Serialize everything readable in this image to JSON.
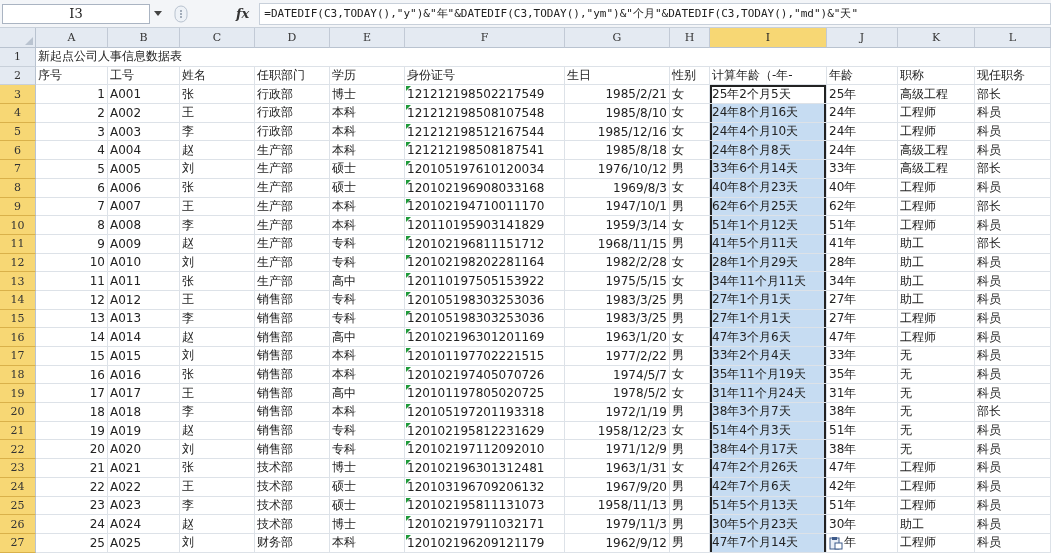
{
  "formula_bar": {
    "name_box": "I3",
    "function_button": "fx",
    "formula": "=DATEDIF(C3,TODAY(),\"y\")&\"年\"&DATEDIF(C3,TODAY(),\"ym\")&\"个月\"&DATEDIF(C3,TODAY(),\"md\")&\"天\""
  },
  "columns": [
    {
      "label": "A",
      "selected": false
    },
    {
      "label": "B",
      "selected": false
    },
    {
      "label": "C",
      "selected": false
    },
    {
      "label": "D",
      "selected": false
    },
    {
      "label": "E",
      "selected": false
    },
    {
      "label": "F",
      "selected": false
    },
    {
      "label": "G",
      "selected": false
    },
    {
      "label": "H",
      "selected": false
    },
    {
      "label": "I",
      "selected": true
    },
    {
      "label": "J",
      "selected": false
    },
    {
      "label": "K",
      "selected": false
    },
    {
      "label": "L",
      "selected": false
    }
  ],
  "rows": [
    {
      "number": "1",
      "kind": "title",
      "selected": false,
      "cells": [
        "新起点公司人事信息数据表",
        null,
        null,
        null,
        null,
        null,
        null,
        null,
        null,
        null,
        null,
        null
      ]
    },
    {
      "number": "2",
      "kind": "header",
      "selected": false,
      "cells": [
        "序号",
        "工号",
        "姓名",
        "任职部门",
        "学历",
        "身份证号",
        "生日",
        "性别",
        "计算年龄（-年-",
        "年龄",
        "职称",
        "现任职务"
      ]
    },
    {
      "number": "3",
      "kind": "record",
      "selected": true,
      "active": true,
      "text_number_warning": true,
      "cells": [
        "1",
        "A001",
        "张",
        "行政部",
        "博士",
        "121212198502217549",
        "1985/2/21",
        "女",
        "25年2个月5天",
        "25年",
        "高级工程",
        "部长"
      ]
    },
    {
      "number": "4",
      "kind": "record",
      "selected": true,
      "active": false,
      "text_number_warning": true,
      "cells": [
        "2",
        "A002",
        "王",
        "行政部",
        "本科",
        "121212198508107548",
        "1985/8/10",
        "女",
        "24年8个月16天",
        "24年",
        "工程师",
        "科员"
      ]
    },
    {
      "number": "5",
      "kind": "record",
      "selected": true,
      "active": false,
      "text_number_warning": true,
      "cells": [
        "3",
        "A003",
        "李",
        "行政部",
        "本科",
        "121212198512167544",
        "1985/12/16",
        "女",
        "24年4个月10天",
        "24年",
        "工程师",
        "科员"
      ]
    },
    {
      "number": "6",
      "kind": "record",
      "selected": true,
      "active": false,
      "text_number_warning": true,
      "cells": [
        "4",
        "A004",
        "赵",
        "生产部",
        "本科",
        "121212198508187541",
        "1985/8/18",
        "女",
        "24年8个月8天",
        "24年",
        "高级工程",
        "科员"
      ]
    },
    {
      "number": "7",
      "kind": "record",
      "selected": true,
      "active": false,
      "text_number_warning": true,
      "cells": [
        "5",
        "A005",
        "刘",
        "生产部",
        "硕士",
        "120105197610120034",
        "1976/10/12",
        "男",
        "33年6个月14天",
        "33年",
        "高级工程",
        "部长"
      ]
    },
    {
      "number": "8",
      "kind": "record",
      "selected": true,
      "active": false,
      "text_number_warning": true,
      "cells": [
        "6",
        "A006",
        "张",
        "生产部",
        "硕士",
        "120102196908033168",
        "1969/8/3",
        "女",
        "40年8个月23天",
        "40年",
        "工程师",
        "科员"
      ]
    },
    {
      "number": "9",
      "kind": "record",
      "selected": true,
      "active": false,
      "text_number_warning": true,
      "cells": [
        "7",
        "A007",
        "王",
        "生产部",
        "本科",
        "120102194710011170",
        "1947/10/1",
        "男",
        "62年6个月25天",
        "62年",
        "工程师",
        "部长"
      ]
    },
    {
      "number": "10",
      "kind": "record",
      "selected": true,
      "active": false,
      "text_number_warning": true,
      "cells": [
        "8",
        "A008",
        "李",
        "生产部",
        "本科",
        "120110195903141829",
        "1959/3/14",
        "女",
        "51年1个月12天",
        "51年",
        "工程师",
        "科员"
      ]
    },
    {
      "number": "11",
      "kind": "record",
      "selected": true,
      "active": false,
      "text_number_warning": true,
      "cells": [
        "9",
        "A009",
        "赵",
        "生产部",
        "专科",
        "120102196811151712",
        "1968/11/15",
        "男",
        "41年5个月11天",
        "41年",
        "助工",
        "部长"
      ]
    },
    {
      "number": "12",
      "kind": "record",
      "selected": true,
      "active": false,
      "text_number_warning": true,
      "cells": [
        "10",
        "A010",
        "刘",
        "生产部",
        "专科",
        "120102198202281164",
        "1982/2/28",
        "女",
        "28年1个月29天",
        "28年",
        "助工",
        "科员"
      ]
    },
    {
      "number": "13",
      "kind": "record",
      "selected": true,
      "active": false,
      "text_number_warning": true,
      "cells": [
        "11",
        "A011",
        "张",
        "生产部",
        "高中",
        "120110197505153922",
        "1975/5/15",
        "女",
        "34年11个月11天",
        "34年",
        "助工",
        "科员"
      ]
    },
    {
      "number": "14",
      "kind": "record",
      "selected": true,
      "active": false,
      "text_number_warning": true,
      "cells": [
        "12",
        "A012",
        "王",
        "销售部",
        "专科",
        "120105198303253036",
        "1983/3/25",
        "男",
        "27年1个月1天",
        "27年",
        "助工",
        "科员"
      ]
    },
    {
      "number": "15",
      "kind": "record",
      "selected": true,
      "active": false,
      "text_number_warning": true,
      "cells": [
        "13",
        "A013",
        "李",
        "销售部",
        "专科",
        "120105198303253036",
        "1983/3/25",
        "男",
        "27年1个月1天",
        "27年",
        "工程师",
        "科员"
      ]
    },
    {
      "number": "16",
      "kind": "record",
      "selected": true,
      "active": false,
      "text_number_warning": true,
      "cells": [
        "14",
        "A014",
        "赵",
        "销售部",
        "高中",
        "120102196301201169",
        "1963/1/20",
        "女",
        "47年3个月6天",
        "47年",
        "工程师",
        "科员"
      ]
    },
    {
      "number": "17",
      "kind": "record",
      "selected": true,
      "active": false,
      "text_number_warning": true,
      "cells": [
        "15",
        "A015",
        "刘",
        "销售部",
        "本科",
        "120101197702221515",
        "1977/2/22",
        "男",
        "33年2个月4天",
        "33年",
        "无",
        "科员"
      ]
    },
    {
      "number": "18",
      "kind": "record",
      "selected": true,
      "active": false,
      "text_number_warning": true,
      "cells": [
        "16",
        "A016",
        "张",
        "销售部",
        "本科",
        "120102197405070726",
        "1974/5/7",
        "女",
        "35年11个月19天",
        "35年",
        "无",
        "科员"
      ]
    },
    {
      "number": "19",
      "kind": "record",
      "selected": true,
      "active": false,
      "text_number_warning": true,
      "cells": [
        "17",
        "A017",
        "王",
        "销售部",
        "高中",
        "120101197805020725",
        "1978/5/2",
        "女",
        "31年11个月24天",
        "31年",
        "无",
        "科员"
      ]
    },
    {
      "number": "20",
      "kind": "record",
      "selected": true,
      "active": false,
      "text_number_warning": true,
      "cells": [
        "18",
        "A018",
        "李",
        "销售部",
        "本科",
        "120105197201193318",
        "1972/1/19",
        "男",
        "38年3个月7天",
        "38年",
        "无",
        "部长"
      ]
    },
    {
      "number": "21",
      "kind": "record",
      "selected": true,
      "active": false,
      "text_number_warning": true,
      "cells": [
        "19",
        "A019",
        "赵",
        "销售部",
        "专科",
        "120102195812231629",
        "1958/12/23",
        "女",
        "51年4个月3天",
        "51年",
        "无",
        "科员"
      ]
    },
    {
      "number": "22",
      "kind": "record",
      "selected": true,
      "active": false,
      "text_number_warning": true,
      "cells": [
        "20",
        "A020",
        "刘",
        "销售部",
        "专科",
        "120102197112092010",
        "1971/12/9",
        "男",
        "38年4个月17天",
        "38年",
        "无",
        "科员"
      ]
    },
    {
      "number": "23",
      "kind": "record",
      "selected": true,
      "active": false,
      "text_number_warning": true,
      "cells": [
        "21",
        "A021",
        "张",
        "技术部",
        "博士",
        "120102196301312481",
        "1963/1/31",
        "女",
        "47年2个月26天",
        "47年",
        "工程师",
        "科员"
      ]
    },
    {
      "number": "24",
      "kind": "record",
      "selected": true,
      "active": false,
      "text_number_warning": true,
      "cells": [
        "22",
        "A022",
        "王",
        "技术部",
        "硕士",
        "120103196709206132",
        "1967/9/20",
        "男",
        "42年7个月6天",
        "42年",
        "工程师",
        "科员"
      ]
    },
    {
      "number": "25",
      "kind": "record",
      "selected": true,
      "active": false,
      "text_number_warning": true,
      "cells": [
        "23",
        "A023",
        "李",
        "技术部",
        "硕士",
        "120102195811131073",
        "1958/11/13",
        "男",
        "51年5个月13天",
        "51年",
        "工程师",
        "科员"
      ]
    },
    {
      "number": "26",
      "kind": "record",
      "selected": true,
      "active": false,
      "text_number_warning": true,
      "cells": [
        "24",
        "A024",
        "赵",
        "技术部",
        "博士",
        "120102197911032171",
        "1979/11/3",
        "男",
        "30年5个月23天",
        "30年",
        "助工",
        "科员"
      ]
    },
    {
      "number": "27",
      "kind": "record",
      "selected": true,
      "active": false,
      "text_number_warning": true,
      "paste_options": true,
      "cells": [
        "25",
        "A025",
        "刘",
        "财务部",
        "本科",
        "120102196209121179",
        "1962/9/12",
        "男",
        "47年7个月14天",
        "年",
        "工程师",
        "科员"
      ]
    }
  ]
}
